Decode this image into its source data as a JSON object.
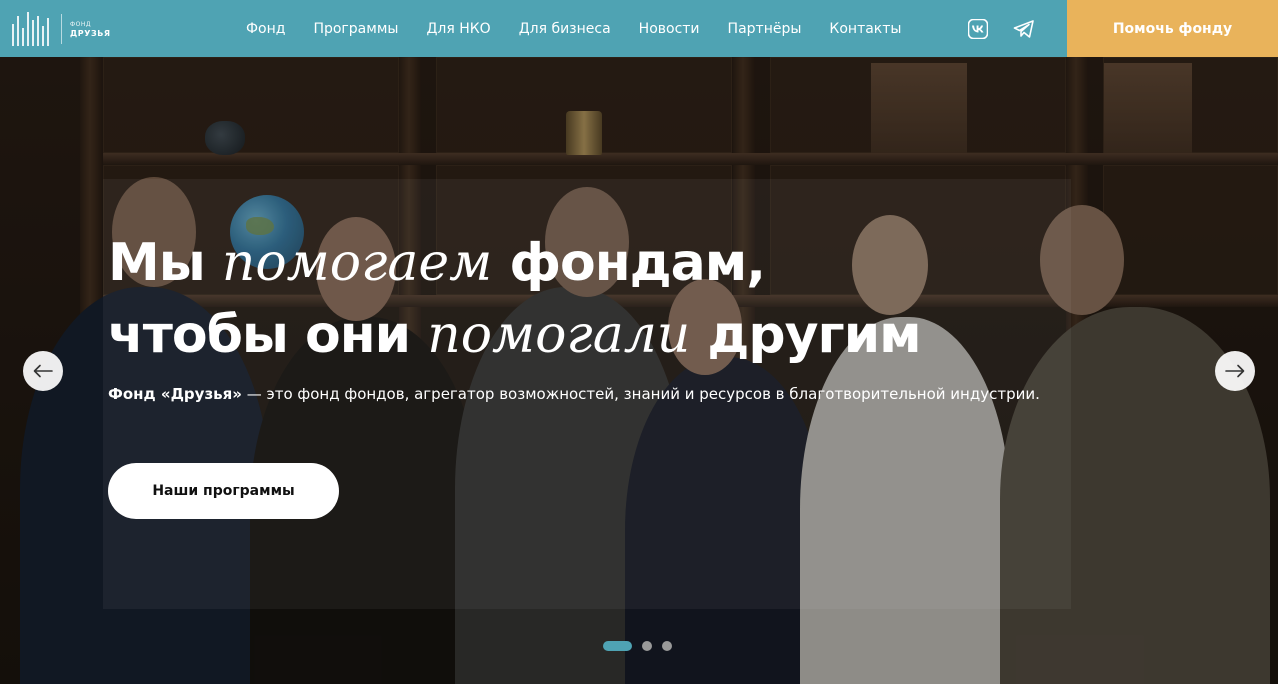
{
  "header": {
    "logo": {
      "small": "ФОНД",
      "big": "ДРУЗЬЯ"
    },
    "nav": [
      {
        "label": "Фонд"
      },
      {
        "label": "Программы"
      },
      {
        "label": "Для НКО"
      },
      {
        "label": "Для бизнеса"
      },
      {
        "label": "Новости"
      },
      {
        "label": "Партнёры"
      },
      {
        "label": "Контакты"
      }
    ],
    "social": {
      "vk_icon": "vk-icon",
      "telegram_icon": "telegram-icon"
    },
    "donate_label": "Помочь фонду"
  },
  "hero": {
    "headline": {
      "l1a": "Мы ",
      "l1b": "помогаем",
      "l1c": " фондам,",
      "l2a": "чтобы они ",
      "l2b": "помогали",
      "l2c": " другим"
    },
    "subtitle_bold": "Фонд «Друзья»",
    "subtitle_rest": " — это фонд фондов, агрегатор возможностей, знаний и ресурсов в благотворительной индустрии.",
    "cta_label": "Наши программы",
    "slider": {
      "prev_icon": "arrow-left-icon",
      "next_icon": "arrow-right-icon",
      "active_slide": 1,
      "slide_count": 3
    }
  },
  "colors": {
    "header_bg": "#4fa3b3",
    "donate_bg": "#e9b35b",
    "active_dot": "#4fa3b3"
  }
}
